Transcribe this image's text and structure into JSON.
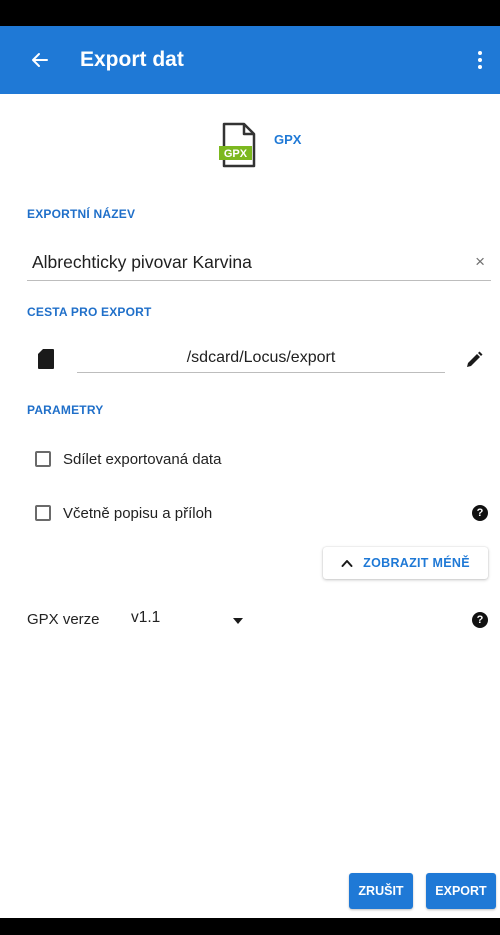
{
  "app_bar": {
    "title": "Export dat",
    "color": "#1f79d6"
  },
  "format": {
    "icon_name": "gpx-file-icon",
    "icon_text": "GPX",
    "label": "GPX"
  },
  "export_name": {
    "section_label": "EXPORTNÍ NÁZEV",
    "value": "Albrechticky pivovar Karvina",
    "clear_symbol": "×"
  },
  "export_path": {
    "section_label": "CESTA PRO EXPORT",
    "value": "/sdcard/Locus/export"
  },
  "parameters": {
    "section_label": "PARAMETRY",
    "share_label": "Sdílet exportovaná data",
    "share_checked": false,
    "include_label": "Včetně popisu a příloh",
    "include_checked": false,
    "toggle_label": "ZOBRAZIT MÉNĚ",
    "gpx_version_label": "GPX verze",
    "gpx_version_value": "v1.1"
  },
  "actions": {
    "cancel_label": "ZRUŠIT",
    "export_label": "EXPORT"
  },
  "help_symbol": "?"
}
